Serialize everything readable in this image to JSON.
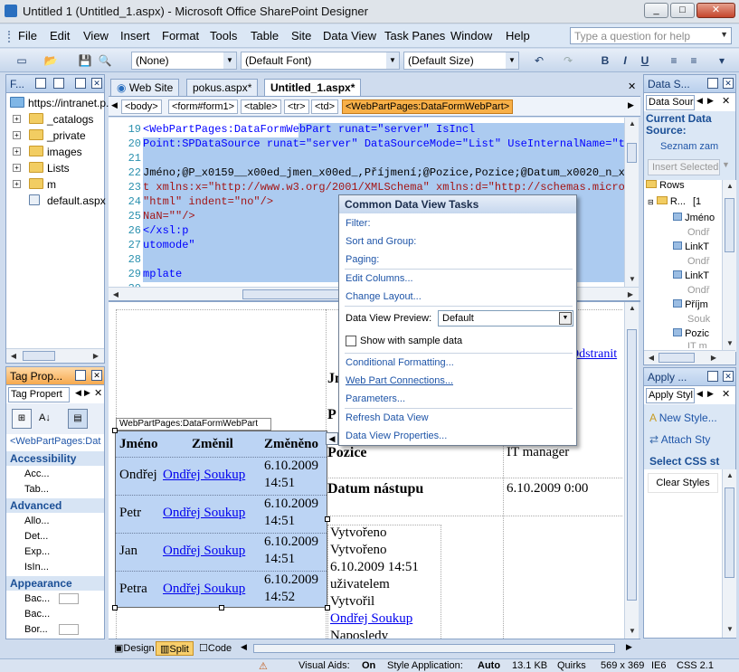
{
  "window": {
    "title": "Untitled 1 (Untitled_1.aspx) - Microsoft Office SharePoint Designer"
  },
  "menu": [
    "File",
    "Edit",
    "View",
    "Insert",
    "Format",
    "Tools",
    "Table",
    "Site",
    "Data View",
    "Task Panes",
    "Window",
    "Help"
  ],
  "question_box": {
    "placeholder": "Type a question for help"
  },
  "toolbar": {
    "style": "(None)",
    "font": "(Default Font)",
    "size": "(Default Size)"
  },
  "folder_panel": {
    "title": "F...",
    "items": [
      "https://intranet.p...",
      "_catalogs",
      "_private",
      "images",
      "Lists",
      "m",
      "default.aspx"
    ]
  },
  "tag_panel": {
    "title": "Tag Prop...",
    "tab": "Tag Propert",
    "crumb": "<WebPartPages:Dat",
    "sections": [
      {
        "name": "Accessibility",
        "props": [
          "Acc...",
          "Tab..."
        ]
      },
      {
        "name": "Advanced",
        "props": [
          "Allo...",
          "Det...",
          "Exp...",
          "IsIn..."
        ]
      },
      {
        "name": "Appearance",
        "props": [
          "Bac...",
          "Bac...",
          "Bor..."
        ]
      }
    ]
  },
  "doc_tabs": [
    "Web Site",
    "pokus.aspx*",
    "Untitled_1.aspx*"
  ],
  "breadcrumbs": [
    "<body>",
    "<form#form1>",
    "<table>",
    "<tr>",
    "<td>",
    "<WebPartPages:DataFormWebPart>"
  ],
  "code_lines": [
    {
      "n": "19",
      "text": "                        <WebPartPages:DataFormWebPart runat=\"server\" IsIncl"
    },
    {
      "n": "20",
      "text": "Point:SPDataSource runat=\"server\" DataSourceMode=\"List\" UseInternalName=\"tru"
    },
    {
      "n": "21",
      "text": ""
    },
    {
      "n": "22",
      "text": "Jméno;@P_x0159__x00ed_jmen_x00ed_,Příjmení;@Pozice,Pozice;@Datum_x0020_n_x00"
    },
    {
      "n": "23",
      "text": "t xmlns:x=\"http://www.w3.org/2001/XMLSchema\" xmlns:d=\"http://schemas.microso"
    },
    {
      "n": "24",
      "text": "\"html\" indent=\"no\"/>"
    },
    {
      "n": "25",
      "text": " NaN=\"\"/>"
    },
    {
      "n": "26",
      "text": "                                                                        </xsl:p"
    },
    {
      "n": "27",
      "text": "                                                                        utomode\""
    },
    {
      "n": "28",
      "text": ""
    },
    {
      "n": "29",
      "text": "                                                                        mplate"
    },
    {
      "n": "30",
      "text": ""
    }
  ],
  "webpart_label": "WebPartPages:DataFormWebPart",
  "data_table": {
    "headers": [
      "Jméno",
      "Změnil",
      "Změněno"
    ],
    "rows": [
      {
        "name": "Ondřej",
        "changed_by": "Ondřej Soukup",
        "date": "6.10.2009",
        "time": "14:51"
      },
      {
        "name": "Petr",
        "changed_by": "Ondřej Soukup",
        "date": "6.10.2009",
        "time": "14:51"
      },
      {
        "name": "Jan",
        "changed_by": "Ondřej Soukup",
        "date": "6.10.2009",
        "time": "14:51"
      },
      {
        "name": "Petra",
        "changed_by": "Ondřej Soukup",
        "date": "6.10.2009",
        "time": "14:52"
      }
    ]
  },
  "detail": {
    "link_right": "Odstranit",
    "j_label": "Jm",
    "p_label": "P",
    "pozice_label": "Pozice",
    "pozice_value": "IT manager",
    "datum_label": "Datum nástupu",
    "datum_value": "6.10.2009 0:00",
    "lines": [
      "Vytvořeno",
      "Vytvořeno",
      "6.10.2009 14:51",
      "uživatelem",
      "Vytvořil"
    ],
    "created_by": "Ondřej Soukup",
    "last_line": "Naposledy změněno"
  },
  "popup": {
    "title": "Common Data View Tasks",
    "group1": [
      "Filter:",
      "Sort and Group:",
      "Paging:"
    ],
    "group2": [
      "Edit Columns...",
      "Change Layout..."
    ],
    "preview_label": "Data View Preview:",
    "preview_value": "Default",
    "sample_label": "Show with sample data",
    "group3": [
      "Conditional Formatting...",
      "Web Part Connections...",
      "Parameters..."
    ],
    "group4": [
      "Refresh Data View",
      "Data View Properties..."
    ]
  },
  "view_tabs": [
    "Design",
    "Split",
    "Code"
  ],
  "datasource_panel": {
    "title": "Data S...",
    "tab": "Data Sour",
    "current": "Current Data Source:",
    "source": "Seznam zam",
    "insert": "Insert Selected",
    "tree": [
      "Rows",
      "R...",
      "Jméno",
      "Ondř",
      "LinkT",
      "Ondř",
      "LinkT",
      "Ondř",
      "Příjm",
      "Souk",
      "Pozic",
      "IT m"
    ],
    "count": "[1"
  },
  "styles_panel": {
    "title": "Apply ...",
    "tab": "Apply Styl",
    "new_style": "New Style...",
    "attach": "Attach Sty",
    "select_label": "Select CSS st",
    "clear": "Clear Styles"
  },
  "status": {
    "visual_aids_label": "Visual Aids:",
    "visual_aids_value": "On",
    "style_app_label": "Style Application:",
    "style_app_value": "Auto",
    "size": "13.1 KB",
    "mode": "Quirks",
    "dims": "569 x 369",
    "browser": "IE6",
    "css": "CSS 2.1"
  },
  "colors": {
    "accent": "#f8b048",
    "selection": "#accbf0",
    "link": "#0000ee"
  }
}
